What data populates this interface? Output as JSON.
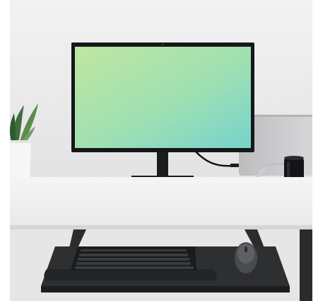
{
  "scene": {
    "kind": "photo",
    "subject": "desk-setup",
    "objects": [
      {
        "name": "monitor",
        "icon": "monitor-icon"
      },
      {
        "name": "laptop",
        "icon": "laptop-icon"
      },
      {
        "name": "potted-plant",
        "icon": "plant-icon"
      },
      {
        "name": "speaker",
        "icon": "speaker-icon"
      },
      {
        "name": "keyboard",
        "icon": "keyboard-icon"
      },
      {
        "name": "mouse",
        "icon": "mouse-icon"
      },
      {
        "name": "keyboard-tray",
        "icon": "tray-icon"
      }
    ],
    "colors": {
      "wall": "#e9e9ea",
      "desk_top": "#f1f1f0",
      "desk_edge": "#d9d9d8",
      "monitor_frame": "#17181a",
      "screen_start": "#b8e6a4",
      "screen_end": "#7fd7c9",
      "tray": "#2c2d2f",
      "keyboard": "#1d1e20",
      "laptop": "#c9c9cb"
    }
  }
}
